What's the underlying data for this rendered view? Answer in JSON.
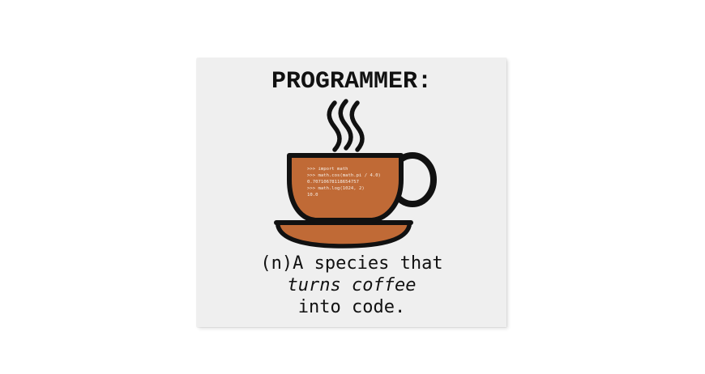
{
  "poster": {
    "title": "PROGRAMMER:",
    "code_lines": [
      ">>> import math",
      ">>> math.cos(math.pi / 4.0)",
      "0.70710678118654757",
      ">>> math.log(1024, 2)",
      "10.0"
    ],
    "definition_line1": "(n)A species that",
    "definition_line2": "turns coffee",
    "definition_line3": "into code."
  },
  "colors": {
    "background": "#ffffff",
    "poster": "#efefef",
    "coffee": "#c06a36",
    "outline": "#111111",
    "text": "#111111"
  },
  "icons": [
    "steam-icon",
    "coffee-cup-icon",
    "saucer-icon"
  ]
}
